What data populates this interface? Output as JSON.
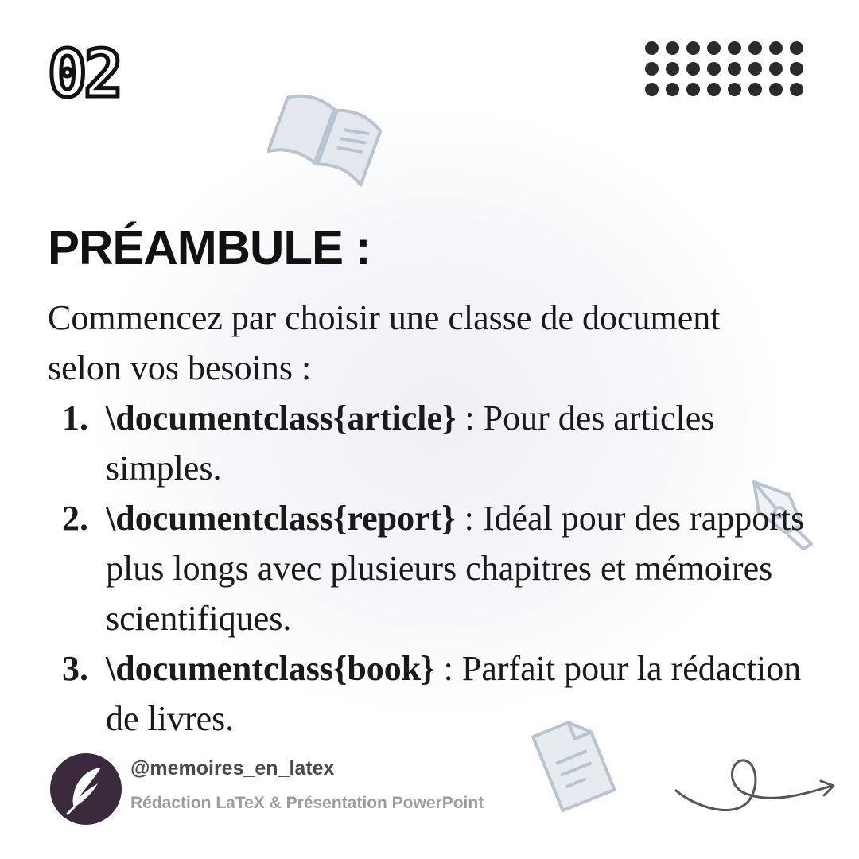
{
  "slide_number": "02",
  "title": "PRÉAMBULE :",
  "intro": "Commencez par choisir une classe de document selon vos besoins :",
  "items": [
    {
      "number": "1.",
      "code": "\\documentclass{article}",
      "text": " : Pour des articles simples."
    },
    {
      "number": "2.",
      "code": "\\documentclass{report}",
      "text": " : Idéal pour des rapports plus longs avec plusieurs chapitres et mémoires scientifiques."
    },
    {
      "number": "3.",
      "code": "\\documentclass{book}",
      "text": " : Parfait pour la rédaction de livres."
    }
  ],
  "footer": {
    "handle": "@memoires_en_latex",
    "tagline": "Rédaction LaTeX & Présentation PowerPoint",
    "avatar_icon": "feather-quill-icon"
  },
  "decorations": [
    "open-book-icon",
    "fountain-pen-icon",
    "document-icon",
    "dot-grid",
    "swirl-arrow-icon"
  ],
  "colors": {
    "text": "#111111",
    "icon_outline": "#b8c4d0",
    "icon_fill": "#e3e8ee",
    "avatar_bg": "#3b2a3c"
  }
}
